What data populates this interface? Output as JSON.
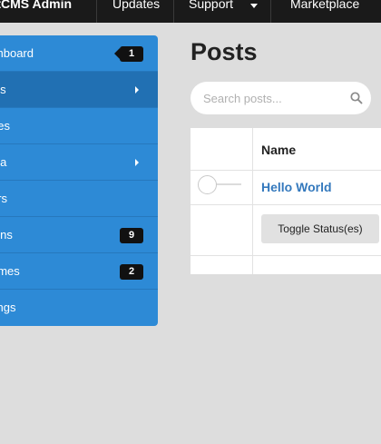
{
  "topnav": {
    "brand": "aptCMS Admin",
    "items": [
      "Updates",
      "Support",
      "Marketplace"
    ]
  },
  "sidebar": {
    "items": [
      {
        "label": "shboard",
        "badge": "1"
      },
      {
        "label": "sts"
      },
      {
        "label": "ges"
      },
      {
        "label": "dia"
      },
      {
        "label": "ers"
      },
      {
        "label": "gins",
        "badge": "9"
      },
      {
        "label": "emes",
        "badge": "2"
      },
      {
        "label": "tings"
      }
    ]
  },
  "main": {
    "title": "Posts",
    "search_placeholder": "Search posts...",
    "table": {
      "header_name": "Name",
      "row_title": "Hello World",
      "toggle_button": "Toggle Status(es)"
    }
  },
  "colors": {
    "navbar": "#1a1a1a",
    "sidebar": "#2d8ad6",
    "sidebar_active": "#2170b3",
    "link": "#3479bd"
  },
  "icons": [
    "search-icon",
    "caret-down-icon",
    "chevron-right-icon"
  ]
}
